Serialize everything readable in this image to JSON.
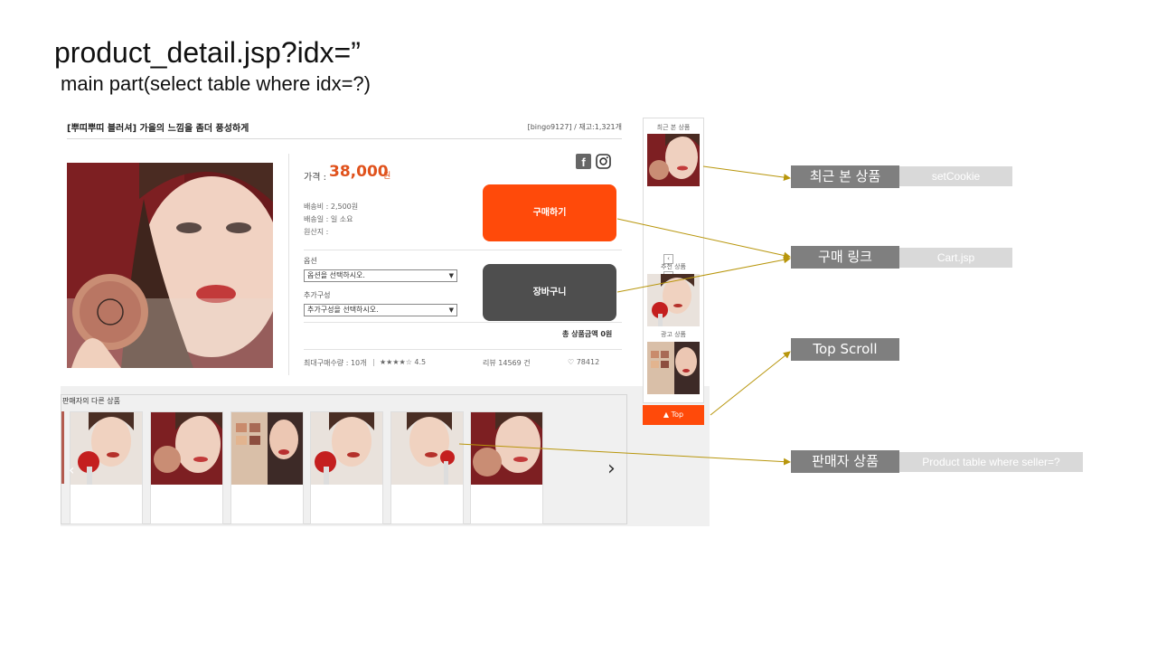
{
  "slide": {
    "title": "product_detail.jsp?idx=”",
    "subtitle": "main part(select table where idx=?)"
  },
  "product": {
    "name": "[뿌띠뿌띠 블러셔] 가을의 느낌을 좀더 풍성하게",
    "seller_stock": "[bingo9127] / 재고:1,321개",
    "price_label": "가격 :",
    "price_value": "38,000",
    "price_unit": "원",
    "shipping_fee": "배송비 : 2,500원",
    "shipping_days": "배송일 : 일 소요",
    "origin": "원산지 :",
    "option_label": "옵션",
    "option_placeholder": "옵션을 선택하시오.",
    "extra_label": "추가구성",
    "extra_placeholder": "추가구성을 선택하시오.",
    "buy_button": "구매하기",
    "cart_button": "장바구니",
    "total_price": "총 상품금액 0원",
    "max_purchase": "최대구매수량 : 10개",
    "rating": "★★★★☆ 4.5",
    "reviews": "리뷰 14569 건",
    "likes": "♡ 78412"
  },
  "seller_products": {
    "title": "판매자의 다른 상품",
    "items": [
      "product-1",
      "product-2",
      "product-3",
      "product-4",
      "product-5",
      "product-6"
    ]
  },
  "side_panel": {
    "recent_title": "최근 본 상품",
    "recommend_title": "추천 상품",
    "ad_title": "광고 상품",
    "top_button": "▲ Top",
    "nav_prev": "‹",
    "nav_next": "›"
  },
  "annotations": {
    "recent_tag": "최근 본 상품",
    "recent_note": "setCookie",
    "buy_tag": "구매 링크",
    "buy_note": "Cart.jsp",
    "scroll_tag": "Top Scroll",
    "seller_tag": "판매자 상품",
    "seller_note": "Product table where seller=?"
  },
  "colors": {
    "accent": "#ff4a0a",
    "price": "#e0521c",
    "cart_button": "#4e4e4e",
    "annotation_tag": "#7f7f7f",
    "annotation_note": "#d9d9d9",
    "connector": "#b8960c"
  }
}
